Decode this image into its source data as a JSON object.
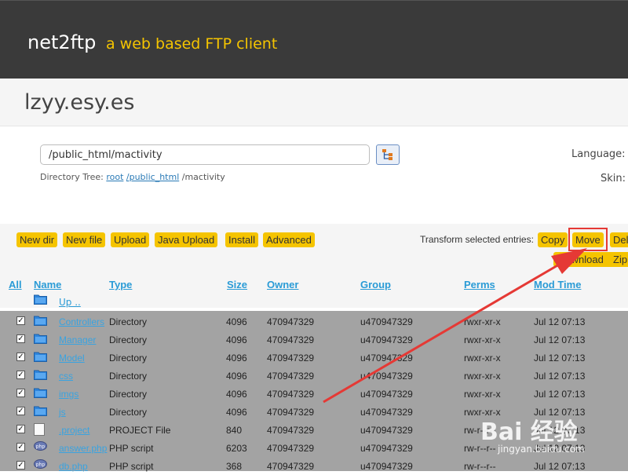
{
  "header": {
    "brand": "net2ftp",
    "tagline": "a web based FTP client"
  },
  "hostname": "lzyy.esy.es",
  "path": {
    "value": "/public_html/mactivity",
    "tree_label": "Directory Tree:",
    "tree_root": "root",
    "tree_mid": "/public_html",
    "tree_cur": "/mactivity"
  },
  "settings": {
    "language_label": "Language:",
    "skin_label": "Skin:"
  },
  "toolbar": {
    "new_dir": "New dir",
    "new_file": "New file",
    "upload": "Upload",
    "java_upload": "Java Upload",
    "install": "Install",
    "advanced": "Advanced",
    "transform_label": "Transform selected entries:",
    "copy": "Copy",
    "move": "Move",
    "delete": "Del",
    "download": "Download",
    "zip": "Zip"
  },
  "columns": {
    "all": "All",
    "name": "Name",
    "type": "Type",
    "size": "Size",
    "owner": "Owner",
    "group": "Group",
    "perms": "Perms",
    "mod_time": "Mod Time"
  },
  "up_label": "Up ..",
  "files": [
    {
      "name": "Controllers",
      "type": "Directory",
      "size": "4096",
      "owner": "470947329",
      "group": "u470947329",
      "perms": "rwxr-xr-x",
      "mod": "Jul 12 07:13",
      "icon": "folder-icon"
    },
    {
      "name": "Manager",
      "type": "Directory",
      "size": "4096",
      "owner": "470947329",
      "group": "u470947329",
      "perms": "rwxr-xr-x",
      "mod": "Jul 12 07:13",
      "icon": "folder-icon"
    },
    {
      "name": "Model",
      "type": "Directory",
      "size": "4096",
      "owner": "470947329",
      "group": "u470947329",
      "perms": "rwxr-xr-x",
      "mod": "Jul 12 07:13",
      "icon": "folder-icon"
    },
    {
      "name": "css",
      "type": "Directory",
      "size": "4096",
      "owner": "470947329",
      "group": "u470947329",
      "perms": "rwxr-xr-x",
      "mod": "Jul 12 07:13",
      "icon": "folder-icon"
    },
    {
      "name": "imgs",
      "type": "Directory",
      "size": "4096",
      "owner": "470947329",
      "group": "u470947329",
      "perms": "rwxr-xr-x",
      "mod": "Jul 12 07:13",
      "icon": "folder-icon"
    },
    {
      "name": "js",
      "type": "Directory",
      "size": "4096",
      "owner": "470947329",
      "group": "u470947329",
      "perms": "rwxr-xr-x",
      "mod": "Jul 12 07:13",
      "icon": "folder-icon"
    },
    {
      "name": ".project",
      "type": "PROJECT File",
      "size": "840",
      "owner": "470947329",
      "group": "u470947329",
      "perms": "rw-r--r--",
      "mod": "Jul 12 07:13",
      "icon": "file-icon"
    },
    {
      "name": "answer.php",
      "type": "PHP script",
      "size": "6203",
      "owner": "470947329",
      "group": "u470947329",
      "perms": "rw-r--r--",
      "mod": "Jul 12 07:13",
      "icon": "php-icon"
    },
    {
      "name": "db.php",
      "type": "PHP script",
      "size": "368",
      "owner": "470947329",
      "group": "u470947329",
      "perms": "rw-r--r--",
      "mod": "Jul 12 07:13",
      "icon": "php-icon"
    }
  ],
  "watermark": {
    "main": "Bai 经验",
    "sub": "jingyan.baidu.com"
  },
  "colors": {
    "accent": "#f5c400",
    "link": "#2a9bd6",
    "header_bg": "#3a3a3a",
    "annotation": "#e53935"
  }
}
